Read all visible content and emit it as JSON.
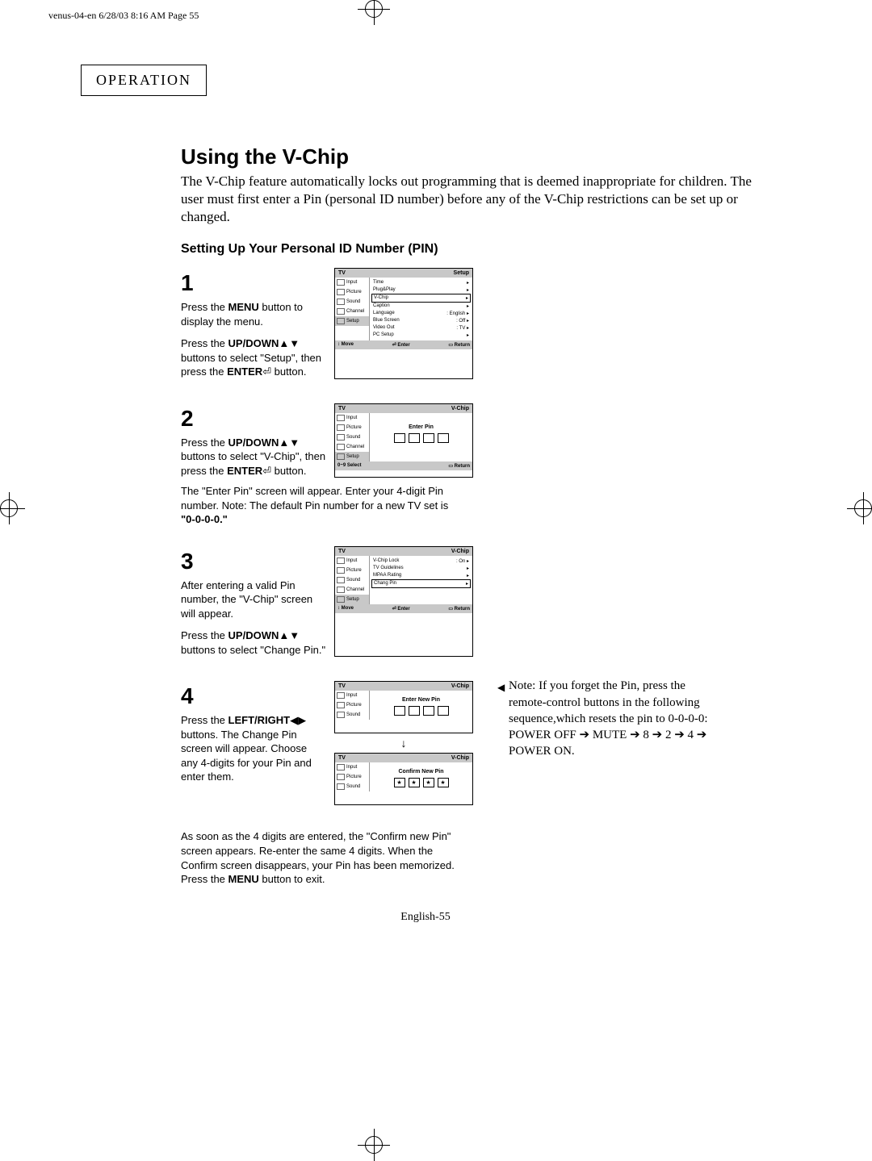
{
  "print_header": "venus-04-en  6/28/03  8:16 AM  Page 55",
  "section_label": "OPERATION",
  "title": "Using the V-Chip",
  "intro": "The V-Chip feature automatically locks out programming that is deemed inappropriate for children. The user must first enter a Pin (personal ID number) before any of the V-Chip restrictions can be set up or changed.",
  "subtitle": "Setting Up Your Personal ID Number (PIN)",
  "steps": {
    "s1": {
      "num": "1",
      "p1a": "Press the ",
      "p1b": "MENU",
      "p1c": " button to display the menu.",
      "p2a": "Press the ",
      "p2b": "UP/DOWN",
      "p2c": "▲▼ buttons to select \"Setup\", then press the ",
      "p2d": "ENTER",
      "p2e": " button."
    },
    "s2": {
      "num": "2",
      "p1a": "Press the ",
      "p1b": "UP/DOWN",
      "p1c": "▲▼ buttons to select \"V-Chip\", then press the ",
      "p1d": "ENTER",
      "p1e": " button.",
      "below": "The \"Enter Pin\" screen will appear. Enter your 4-digit Pin number. Note: The default Pin number for a new TV set is",
      "default_pin": "\"0-0-0-0.\""
    },
    "s3": {
      "num": "3",
      "p1": "After entering a valid Pin number, the \"V-Chip\" screen will appear.",
      "p2a": "Press the ",
      "p2b": "UP/DOWN",
      "p2c": "▲▼ buttons to select \"Change Pin.\""
    },
    "s4": {
      "num": "4",
      "p1a": "Press the ",
      "p1b": "LEFT/RIGHT",
      "p1c": "◀▶ buttons. The Change Pin screen will appear. Choose any 4-digits for your Pin and enter them.",
      "below": "As soon as the 4 digits are entered, the \"Confirm new Pin\" screen appears. Re-enter the same 4 digits. When the Confirm screen disappears, your Pin has been memorized.",
      "exit_a": "Press the ",
      "exit_b": "MENU",
      "exit_c": " button to exit."
    }
  },
  "osd": {
    "side_items": [
      "Input",
      "Picture",
      "Sound",
      "Channel",
      "Setup"
    ],
    "setup": {
      "title_left": "TV",
      "title_right": "Setup",
      "rows": [
        {
          "label": "Time",
          "value": "▸"
        },
        {
          "label": "Plug&Play",
          "value": "▸"
        },
        {
          "label": "V-Chip",
          "value": "▸",
          "boxed": true
        },
        {
          "label": "Caption",
          "value": "▸"
        },
        {
          "label": "Language",
          "value": ": English     ▸"
        },
        {
          "label": "Blue Screen",
          "value": ": Off           ▸"
        },
        {
          "label": "Video Out",
          "value": ": TV            ▸"
        },
        {
          "label": "PC Setup",
          "value": "▸"
        }
      ],
      "footer": [
        "↕ Move",
        "⏎ Enter",
        "▭ Return"
      ]
    },
    "enter_pin": {
      "title_left": "TV",
      "title_right": "V-Chip",
      "center": "Enter Pin",
      "footer": [
        "0~9  Select",
        "",
        "▭ Return"
      ]
    },
    "vchip_menu": {
      "title_left": "TV",
      "title_right": "V-Chip",
      "rows": [
        {
          "label": "V-Chip Lock",
          "value": ": On     ▸"
        },
        {
          "label": "TV Guidelines",
          "value": "▸"
        },
        {
          "label": "MPAA Rating",
          "value": "▸"
        },
        {
          "label": "Chang Pin",
          "value": "▸",
          "boxed": true
        }
      ],
      "footer": [
        "↕ Move",
        "⏎ Enter",
        "▭ Return"
      ]
    },
    "enter_new": {
      "title_left": "TV",
      "title_right": "V-Chip",
      "center": "Enter New Pin"
    },
    "confirm_new": {
      "title_left": "TV",
      "title_right": "V-Chip",
      "center": "Confirm New Pin",
      "star": "★"
    }
  },
  "note": {
    "label": "Note:",
    "line1": "If you forget the Pin, press the remote-control buttons in the following sequence,which resets the pin to 0-0-0-0:",
    "line2": "POWER OFF ➔ MUTE ➔ 8 ➔ 2 ➔ 4 ➔ POWER ON."
  },
  "page_footer": "English-55"
}
